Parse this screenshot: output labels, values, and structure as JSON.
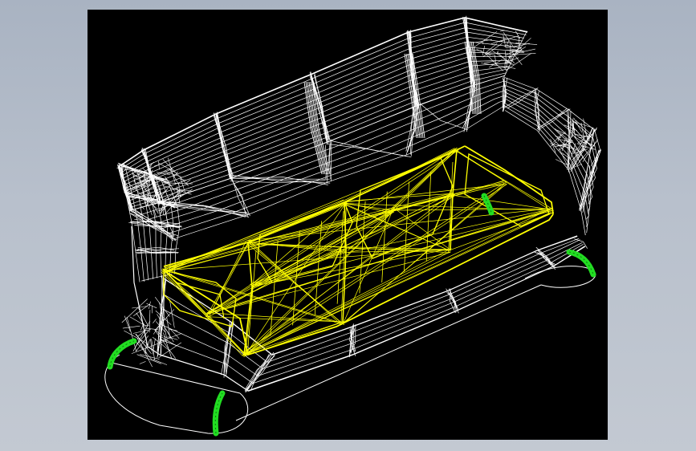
{
  "viewport": {
    "background": "#000000",
    "page_background": "#b4bcc8"
  },
  "model": {
    "subject": "sofa",
    "render_mode": "wireframe",
    "colors": {
      "body": "#ffffff",
      "frame": "#ffff00",
      "feet": "#22dd22",
      "base_outline": "#ffffff"
    }
  }
}
